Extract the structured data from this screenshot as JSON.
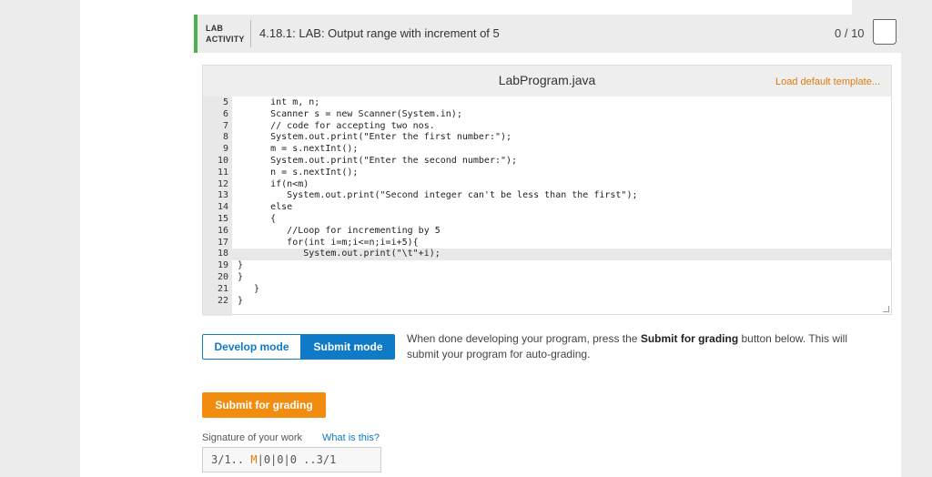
{
  "header": {
    "label_line1": "LAB",
    "label_line2": "ACTIVITY",
    "title": "4.18.1: LAB: Output range with increment of 5",
    "score": "0 / 10"
  },
  "editor": {
    "filename": "LabProgram.java",
    "load_template": "Load default template...",
    "active_line": 18,
    "lines": [
      {
        "n": "5",
        "code": "      int m, n;"
      },
      {
        "n": "6",
        "code": "      Scanner s = new Scanner(System.in);"
      },
      {
        "n": "7",
        "code": "      // code for accepting two nos."
      },
      {
        "n": "8",
        "code": "      System.out.print(\"Enter the first number:\");"
      },
      {
        "n": "9",
        "code": "      m = s.nextInt();"
      },
      {
        "n": "10",
        "code": "      System.out.print(\"Enter the second number:\");"
      },
      {
        "n": "11",
        "code": "      n = s.nextInt();"
      },
      {
        "n": "12",
        "code": "      if(n<m)"
      },
      {
        "n": "13",
        "code": "         System.out.print(\"Second integer can't be less than the first\");"
      },
      {
        "n": "14",
        "code": "      else"
      },
      {
        "n": "15",
        "code": "      {"
      },
      {
        "n": "16",
        "code": "         //Loop for incrementing by 5"
      },
      {
        "n": "17",
        "code": "         for(int i=m;i<=n;i=i+5){"
      },
      {
        "n": "18",
        "code": "            System.out.print(\"\\t\"+i);"
      },
      {
        "n": "19",
        "code": "}"
      },
      {
        "n": "20",
        "code": "}"
      },
      {
        "n": "21",
        "code": "   }"
      },
      {
        "n": "22",
        "code": "}"
      }
    ]
  },
  "modes": {
    "develop": "Develop mode",
    "submit": "Submit mode",
    "selected": "Submit mode"
  },
  "instructions": {
    "prefix": "When done developing your program, press the ",
    "bold": "Submit for grading",
    "suffix": " button below. This will submit your program for auto-grading."
  },
  "submit_button": "Submit for grading",
  "signature": {
    "label": "Signature of your work",
    "help_link": "What is this?",
    "part1": "3/1.. ",
    "part2": "M",
    "part3": "|0|0|0 ..3/1"
  },
  "colors": {
    "accent_green": "#4caf50",
    "primary_blue": "#0f7ac7",
    "orange": "#f28c0f"
  },
  "icons": {
    "badge": "completion-badge-icon",
    "resize": "resize-handle-icon"
  }
}
